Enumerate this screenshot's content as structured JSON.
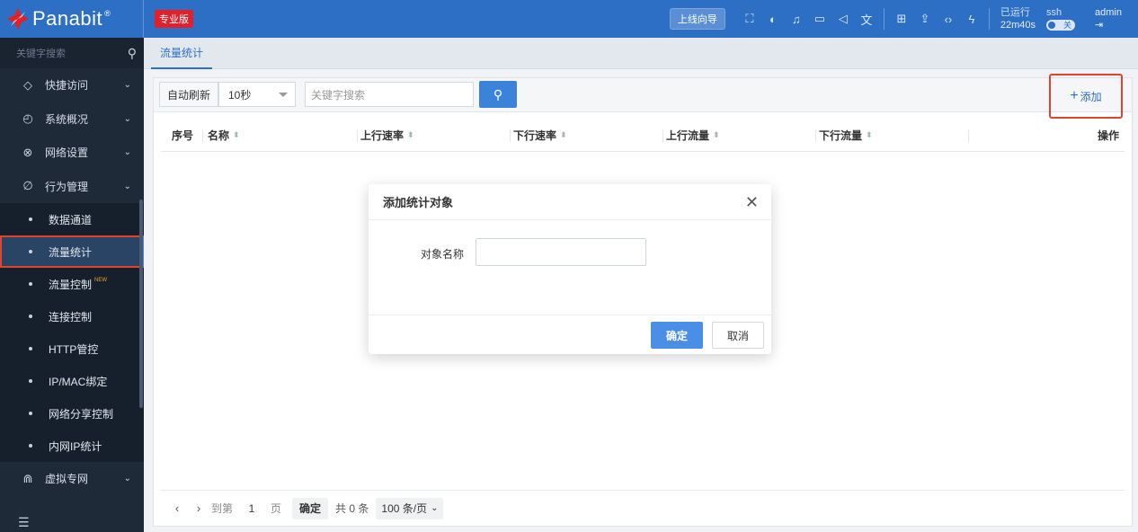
{
  "header": {
    "brand": "Panabit",
    "brand_reg": "®",
    "edition": "专业版",
    "wizard": "上线向导",
    "uptime_label": "已运行",
    "uptime_value": "22m40s",
    "ssh_label": "ssh",
    "ssh_toggle": "关",
    "user": "admin",
    "colors": {
      "bar": "#2d6fc4",
      "edition_bg": "#e0202a"
    }
  },
  "sidebar": {
    "search_placeholder": "关键字搜索",
    "groups": [
      {
        "label": "快捷访问",
        "icon": "diamond-icon"
      },
      {
        "label": "系统概况",
        "icon": "gauge-icon"
      },
      {
        "label": "网络设置",
        "icon": "network-icon"
      },
      {
        "label": "行为管理",
        "icon": "leaf-icon"
      }
    ],
    "sub_items": [
      "数据通道",
      "流量统计",
      "流量控制",
      "连接控制",
      "HTTP管控",
      "IP/MAC绑定",
      "网络分享控制",
      "内网IP统计"
    ],
    "new_badge": "NEW",
    "bottom_group": {
      "label": "虚拟专网",
      "icon": "tunnel-icon"
    },
    "active_item": "流量统计"
  },
  "tabs": [
    {
      "label": "流量统计"
    }
  ],
  "toolbar": {
    "auto_refresh": "自动刷新",
    "interval": "10秒",
    "search_placeholder": "关键字搜索",
    "add_label": "添加"
  },
  "table": {
    "columns": [
      "序号",
      "名称",
      "上行速率",
      "下行速率",
      "上行流量",
      "下行流量",
      "操作"
    ],
    "rows": []
  },
  "pager": {
    "goto": "到第",
    "page": "1",
    "page_unit": "页",
    "confirm": "确定",
    "total": "共 0 条",
    "page_size": "100 条/页"
  },
  "modal": {
    "title": "添加统计对象",
    "field_label": "对象名称",
    "field_value": "",
    "ok": "确定",
    "cancel": "取消"
  }
}
